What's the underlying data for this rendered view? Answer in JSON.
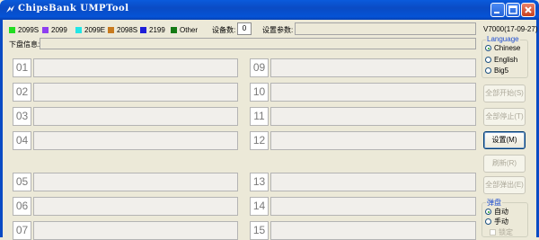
{
  "window": {
    "title": "ChipsBank UMPTool"
  },
  "legend": [
    {
      "label": "2099S",
      "color": "#22dd22"
    },
    {
      "label": "2099",
      "color": "#8e3ff0"
    },
    {
      "label": "2099E",
      "color": "#22e6e6"
    },
    {
      "label": "2098S",
      "color": "#c87a1e"
    },
    {
      "label": "2199",
      "color": "#1e1ed8"
    },
    {
      "label": "Other",
      "color": "#157a15"
    }
  ],
  "device_count": {
    "label": "设备数:",
    "value": "0"
  },
  "settings_params": {
    "label": "设置参数:",
    "value": ""
  },
  "version": "V7000(17-09-27)",
  "disk_info": {
    "label": "下盘信息:",
    "value": ""
  },
  "slots": {
    "left": [
      {
        "num": "01",
        "value": ""
      },
      {
        "num": "02",
        "value": ""
      },
      {
        "num": "03",
        "value": ""
      },
      {
        "num": "04",
        "value": ""
      },
      {
        "num": "05",
        "value": ""
      },
      {
        "num": "06",
        "value": ""
      },
      {
        "num": "07",
        "value": ""
      }
    ],
    "right": [
      {
        "num": "09",
        "value": ""
      },
      {
        "num": "10",
        "value": ""
      },
      {
        "num": "11",
        "value": ""
      },
      {
        "num": "12",
        "value": ""
      },
      {
        "num": "13",
        "value": ""
      },
      {
        "num": "14",
        "value": ""
      },
      {
        "num": "15",
        "value": ""
      }
    ]
  },
  "language": {
    "title": "Language",
    "options": [
      "Chinese",
      "English",
      "Big5"
    ],
    "selected": "Chinese"
  },
  "buttons": {
    "start_all": "全部开始(S)",
    "stop_all": "全部停止(T)",
    "settings": "设置(M)",
    "refresh": "刷新(R)",
    "eject_all": "全部弹出(E)"
  },
  "eject_group": {
    "title": "弹盘",
    "options": [
      "自动",
      "手动"
    ],
    "selected": "自动",
    "lock_label": "锁定"
  }
}
